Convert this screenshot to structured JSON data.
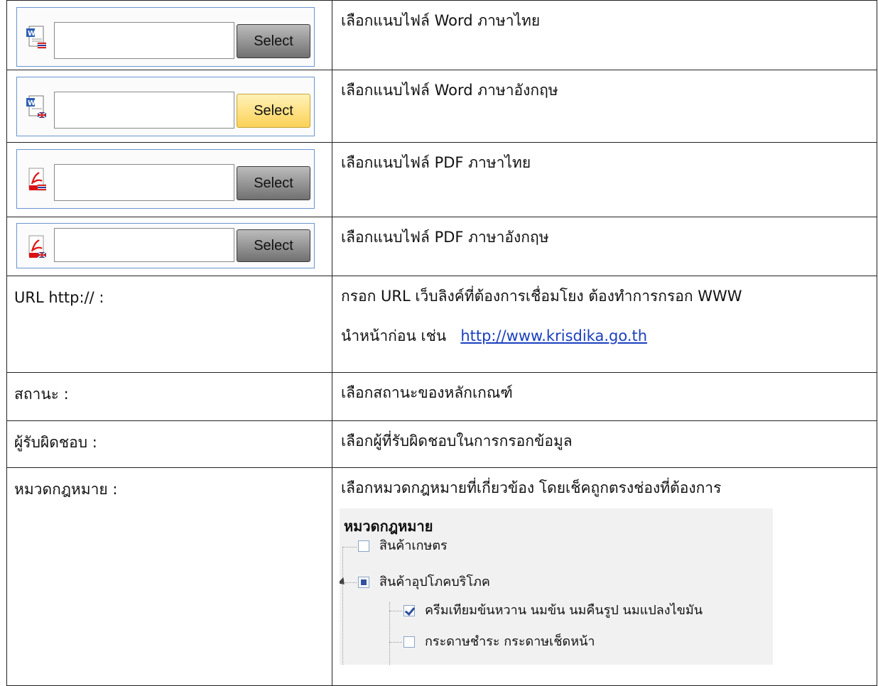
{
  "file_rows": [
    {
      "button": "Select",
      "description": "เลือกแนบไฟล์ Word ภาษาไทย",
      "icon": "word-doc-thai-icon"
    },
    {
      "button": "Select",
      "description": "เลือกแนบไฟล์ Word ภาษาอังกฤษ",
      "icon": "word-doc-english-icon"
    },
    {
      "button": "Select",
      "description": "เลือกแนบไฟล์ PDF ภาษาไทย",
      "icon": "pdf-thai-icon"
    },
    {
      "button": "Select",
      "description": "เลือกแนบไฟล์ PDF ภาษาอังกฤษ",
      "icon": "pdf-english-icon"
    }
  ],
  "url_row": {
    "label": "URL http:// :",
    "line1": "กรอก URL เว็บลิงค์ที่ต้องการเชื่อมโยง ต้องทำการกรอก WWW",
    "line2_prefix": "นำหน้าก่อน เช่น ",
    "link": "http://www.krisdika.go.th"
  },
  "status_row": {
    "label": "สถานะ :",
    "description": "เลือกสถานะของหลักเกณฑ์"
  },
  "owner_row": {
    "label": "ผู้รับผิดชอบ :",
    "description": "เลือกผู้ที่รับผิดชอบในการกรอกข้อมูล"
  },
  "category_row": {
    "label": "หมวดกฎหมาย :",
    "description": "เลือกหมวดกฎหมายที่เกี่ยวข้อง โดยเช็คถูกตรงช่องที่ต้องการ",
    "tree": {
      "title": "หมวดกฎหมาย",
      "nodes": [
        {
          "label": "สินค้าเกษตร",
          "state": "unchecked"
        },
        {
          "label": "สินค้าอุปโภคบริโภค",
          "state": "partial",
          "expanded": true
        },
        {
          "label": "ครีมเทียมข้นหวาน นมข้น นมคืนรูป นมแปลงไขมัน",
          "state": "checked"
        },
        {
          "label": "กระดาษชำระ กระดาษเช็ดหน้า",
          "state": "unchecked"
        }
      ]
    }
  },
  "colors": {
    "widget_border": "#6a96cf",
    "button_highlight": "#fcd156",
    "link": "#1a3fbf",
    "tree_bg": "#f1f1f1"
  }
}
